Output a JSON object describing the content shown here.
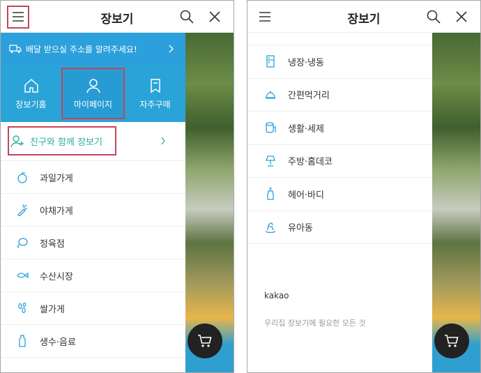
{
  "app_title": "장보기",
  "left": {
    "address_banner": "배달 받으실 주소를 알려주세요!",
    "tabs": [
      {
        "label": "장보기홈",
        "icon": "home-icon"
      },
      {
        "label": "마이페이지",
        "icon": "user-icon"
      },
      {
        "label": "자주구매",
        "icon": "bookmark-icon"
      }
    ],
    "friend_shop": "친구와 함께 장보기",
    "categories": [
      {
        "label": "과일가게",
        "icon": "fruit-icon"
      },
      {
        "label": "야채가게",
        "icon": "carrot-icon"
      },
      {
        "label": "정육점",
        "icon": "meat-icon"
      },
      {
        "label": "수산시장",
        "icon": "fish-icon"
      },
      {
        "label": "쌀가게",
        "icon": "rice-icon"
      },
      {
        "label": "생수·음료",
        "icon": "bottle-icon"
      }
    ]
  },
  "right": {
    "categories": [
      {
        "label": "냉장·냉동",
        "icon": "fridge-icon"
      },
      {
        "label": "간편먹거리",
        "icon": "cloche-icon"
      },
      {
        "label": "생활·세제",
        "icon": "tissue-icon"
      },
      {
        "label": "주방·홈데코",
        "icon": "lamp-icon"
      },
      {
        "label": "헤어·바디",
        "icon": "pump-bottle-icon"
      },
      {
        "label": "유아동",
        "icon": "rocking-horse-icon"
      }
    ],
    "footer_brand": "kakao",
    "footer_desc": "우리집 장보기에 필요한 모든 것"
  },
  "colors": {
    "accent": "#2ba0dc",
    "green": "#2fae9f",
    "annotation": "#c2455a"
  }
}
